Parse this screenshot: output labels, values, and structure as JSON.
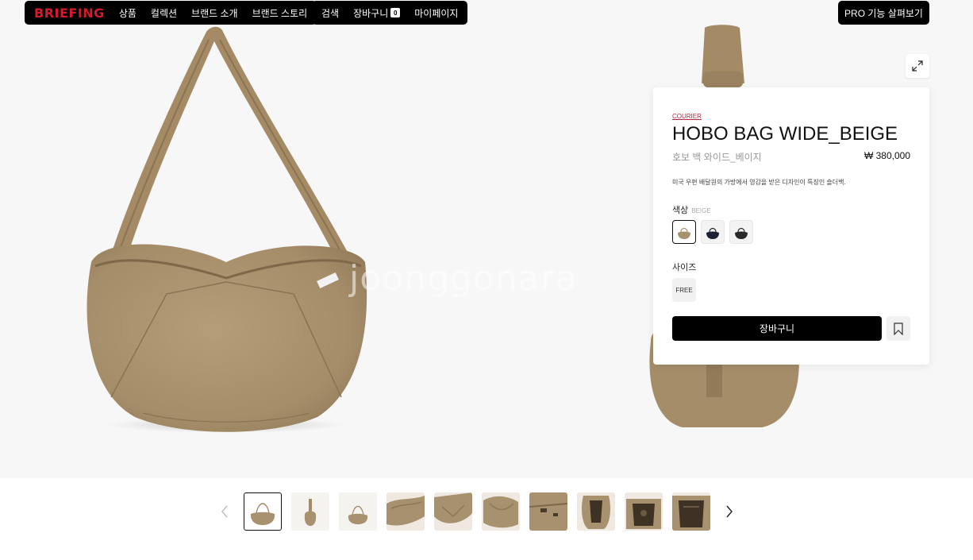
{
  "nav": {
    "logo": "BRIEFING",
    "left_links": [
      "상품",
      "컬렉션",
      "브랜드 소개",
      "브랜드 스토리"
    ],
    "search": "검색",
    "cart": "장바구니",
    "cart_count": "0",
    "mypage": "마이페이지",
    "pro": "PRO 기능 살펴보기"
  },
  "watermark": "joonggonara",
  "product": {
    "brand": "COURIER",
    "title": "HOBO BAG WIDE_BEIGE",
    "subtitle": "호보 백 와이드_베이지",
    "price": "₩ 380,000",
    "description": "미국 우편 배달원의 가방에서 영감을 받은 디자인이 특징인 숄더백.",
    "color_label": "색상",
    "color_value": "BEIGE",
    "colors": [
      {
        "name": "beige",
        "hex": "#a8916e"
      },
      {
        "name": "navy",
        "hex": "#1d2233"
      },
      {
        "name": "black",
        "hex": "#2a2a2a"
      }
    ],
    "size_label": "사이즈",
    "size_value": "FREE",
    "cart_button": "장바구니"
  },
  "colors": {
    "bag": "#a8916e",
    "bag_dark": "#8c7656",
    "bag_light": "#bda684",
    "accent": "#c0243c"
  },
  "thumbnails": [
    "front",
    "side",
    "front-small",
    "detail-1",
    "detail-2",
    "detail-3",
    "detail-4",
    "interior-1",
    "interior-2",
    "interior-3"
  ]
}
